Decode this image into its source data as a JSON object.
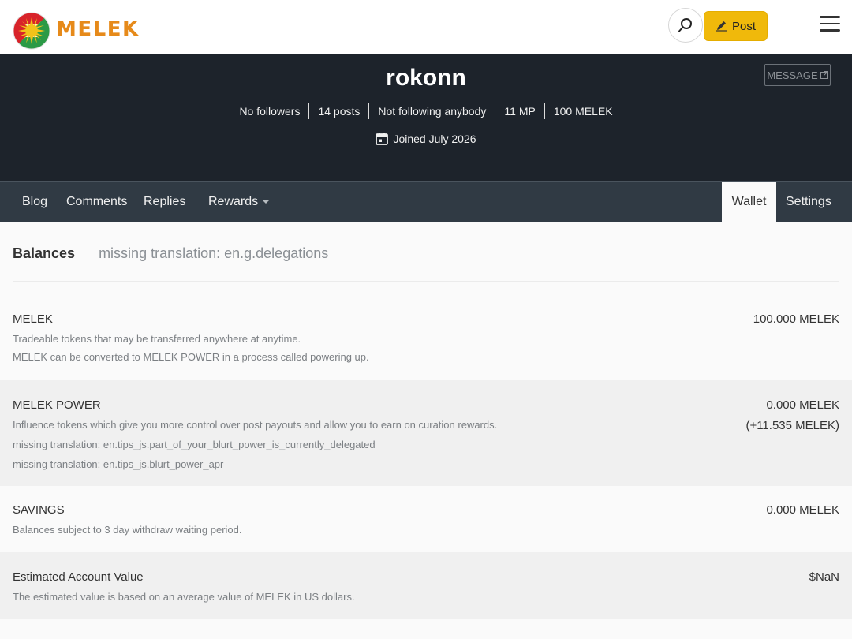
{
  "header": {
    "brand": "MELEK",
    "post_label": "Post"
  },
  "profile": {
    "username": "rokonn",
    "message_label": "MESSAGE",
    "stats": [
      "No followers",
      "14 posts",
      "Not following anybody",
      "11 MP",
      "100 MELEK"
    ],
    "joined": "Joined July 2026"
  },
  "tabs": {
    "blog": "Blog",
    "comments": "Comments",
    "replies": "Replies",
    "rewards": "Rewards",
    "wallet": "Wallet",
    "settings": "Settings"
  },
  "wallet": {
    "subtabs": {
      "balances": "Balances",
      "delegations": "missing translation: en.g.delegations"
    },
    "rows": [
      {
        "title": "MELEK",
        "desc": [
          "Tradeable tokens that may be transferred anywhere at anytime.",
          "MELEK can be converted to MELEK POWER in a process called powering up."
        ],
        "value": "100.000 MELEK"
      },
      {
        "title": "MELEK POWER",
        "desc": [
          "Influence tokens which give you more control over post payouts and allow you to earn on curation rewards.",
          "missing translation: en.tips_js.part_of_your_blurt_power_is_currently_delegated",
          "missing translation: en.tips_js.blurt_power_apr"
        ],
        "value": "0.000 MELEK",
        "value2": "(+11.535 MELEK)"
      },
      {
        "title": "SAVINGS",
        "desc": [
          "Balances subject to 3 day withdraw waiting period."
        ],
        "value": "0.000 MELEK"
      },
      {
        "title": "Estimated Account Value",
        "desc": [
          "The estimated value is based on an average value of MELEK in US dollars."
        ],
        "value": "$NaN"
      }
    ]
  },
  "colors": {
    "brand": "#e68a1a",
    "post_button": "#f0b90b",
    "banner_bg": "#1d232b",
    "tabbar_bg": "#303a44"
  },
  "icons": [
    "logo-icon",
    "search-icon",
    "pencil-icon",
    "hamburger-menu-icon",
    "external-link-icon",
    "calendar-icon",
    "caret-down-icon"
  ]
}
